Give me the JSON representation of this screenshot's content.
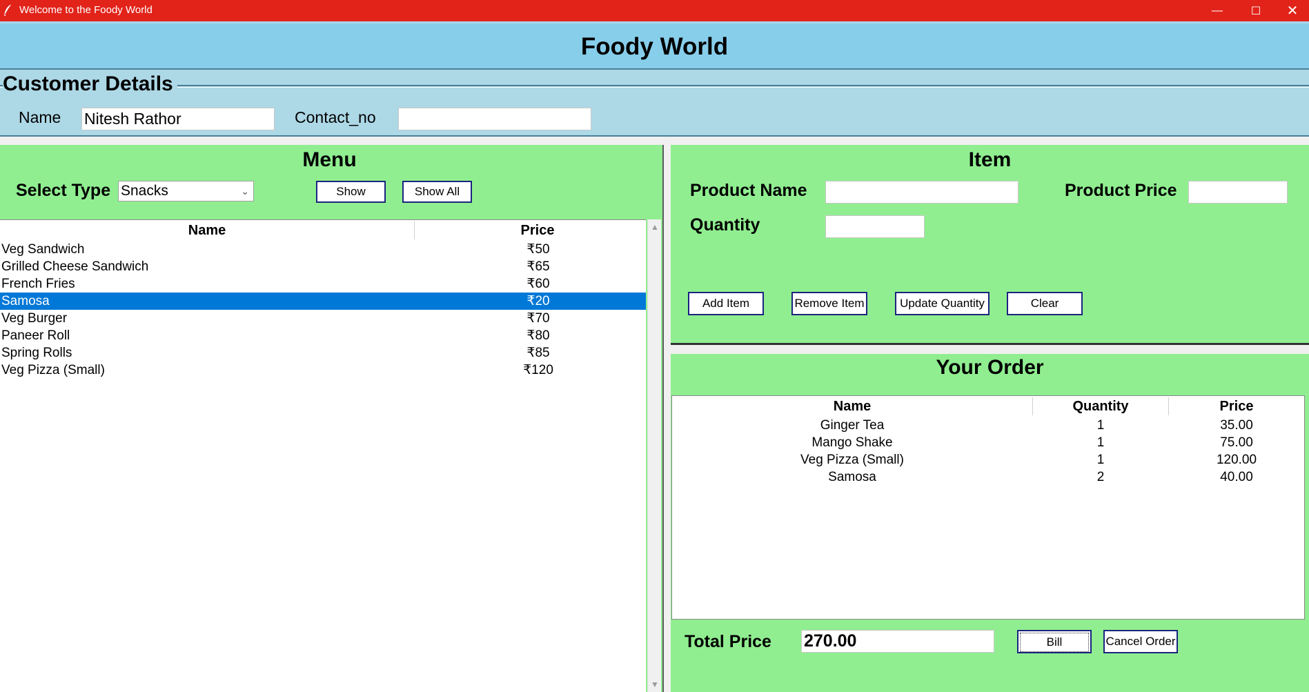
{
  "window": {
    "title": "Welcome to the Foody World",
    "controls": {
      "minimize": "—",
      "maximize": "☐",
      "close": "✕"
    }
  },
  "app": {
    "title": "Foody World"
  },
  "customer": {
    "section_title": "Customer Details",
    "name_label": "Name",
    "name_value": "Nitesh Rathor",
    "contact_label": "Contact_no",
    "contact_value": ""
  },
  "menu": {
    "title": "Menu",
    "select_label": "Select Type",
    "select_value": "Snacks",
    "show_button": "Show",
    "show_all_button": "Show All",
    "columns": {
      "name": "Name",
      "price": "Price"
    },
    "selected_index": 3,
    "rows": [
      {
        "name": "Veg Sandwich",
        "price": "₹50"
      },
      {
        "name": "Grilled Cheese Sandwich",
        "price": "₹65"
      },
      {
        "name": "French Fries",
        "price": "₹60"
      },
      {
        "name": "Samosa",
        "price": "₹20"
      },
      {
        "name": "Veg Burger",
        "price": "₹70"
      },
      {
        "name": "Paneer Roll",
        "price": "₹80"
      },
      {
        "name": "Spring Rolls",
        "price": "₹85"
      },
      {
        "name": "Veg Pizza (Small)",
        "price": "₹120"
      }
    ]
  },
  "item": {
    "title": "Item",
    "product_name_label": "Product Name",
    "product_name_value": "",
    "product_price_label": "Product Price",
    "product_price_value": "",
    "quantity_label": "Quantity",
    "quantity_value": "",
    "buttons": {
      "add": "Add Item",
      "remove": "Remove Item",
      "update": "Update Quantity",
      "clear": "Clear"
    }
  },
  "order": {
    "title": "Your Order",
    "columns": {
      "name": "Name",
      "quantity": "Quantity",
      "price": "Price"
    },
    "rows": [
      {
        "name": "Ginger Tea",
        "quantity": "1",
        "price": "35.00"
      },
      {
        "name": "Mango Shake",
        "quantity": "1",
        "price": "75.00"
      },
      {
        "name": "Veg Pizza (Small)",
        "quantity": "1",
        "price": "120.00"
      },
      {
        "name": "Samosa",
        "quantity": "2",
        "price": "40.00"
      }
    ],
    "total_label": "Total Price",
    "total_value": "270.00",
    "bill_button": "Bill",
    "cancel_button": "Cancel Order"
  },
  "colors": {
    "titlebar": "#e2231a",
    "header": "#87ceeb",
    "customer_bg": "#add8e6",
    "panel_bg": "#90ee90",
    "selection": "#0078d7",
    "button_border": "#1a237e"
  },
  "icons": {
    "app": "feather-icon",
    "dropdown": "chevron-down-icon"
  }
}
